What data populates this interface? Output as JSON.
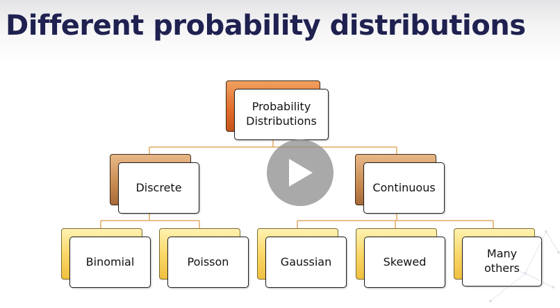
{
  "slide": {
    "title": "Different probability distributions"
  },
  "diagram": {
    "root": "Probability Distributions",
    "discrete": {
      "label": "Discrete",
      "children": [
        "Binomial",
        "Poisson"
      ]
    },
    "continuous": {
      "label": "Continuous",
      "children": [
        "Gaussian",
        "Skewed",
        "Many others"
      ]
    }
  },
  "player": {
    "icon": "play-icon"
  },
  "colors": {
    "title": "#1f2150",
    "root_accent": "#e06a28",
    "mid_accent": "#c88a50",
    "leaf_accent": "#fad76a",
    "connector": "#e0a860"
  }
}
